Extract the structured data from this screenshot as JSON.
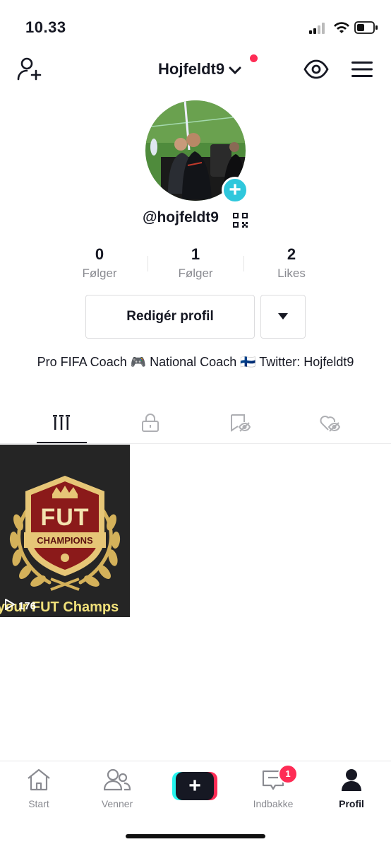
{
  "status_bar": {
    "time": "10.33"
  },
  "header": {
    "username": "Hojfeldt9",
    "handle": "@hojfeldt9"
  },
  "stats": [
    {
      "value": "0",
      "label": "Følger"
    },
    {
      "value": "1",
      "label": "Følger"
    },
    {
      "value": "2",
      "label": "Likes"
    }
  ],
  "buttons": {
    "edit_profile": "Redigér profil"
  },
  "bio": "Pro FIFA Coach 🎮 National Coach 🇫🇮 Twitter: Hojfeldt9",
  "video": {
    "badge_top": "FUT",
    "badge_bottom": "CHAMPIONS",
    "views": "176",
    "caption": "your FUT Champs"
  },
  "nav": {
    "start": "Start",
    "friends": "Venner",
    "inbox": "Indbakke",
    "inbox_badge": "1",
    "profile": "Profil"
  },
  "colors": {
    "accent_pink": "#fe2c55",
    "accent_cyan": "#25f4ee",
    "add_badge": "#2fc7dc"
  }
}
